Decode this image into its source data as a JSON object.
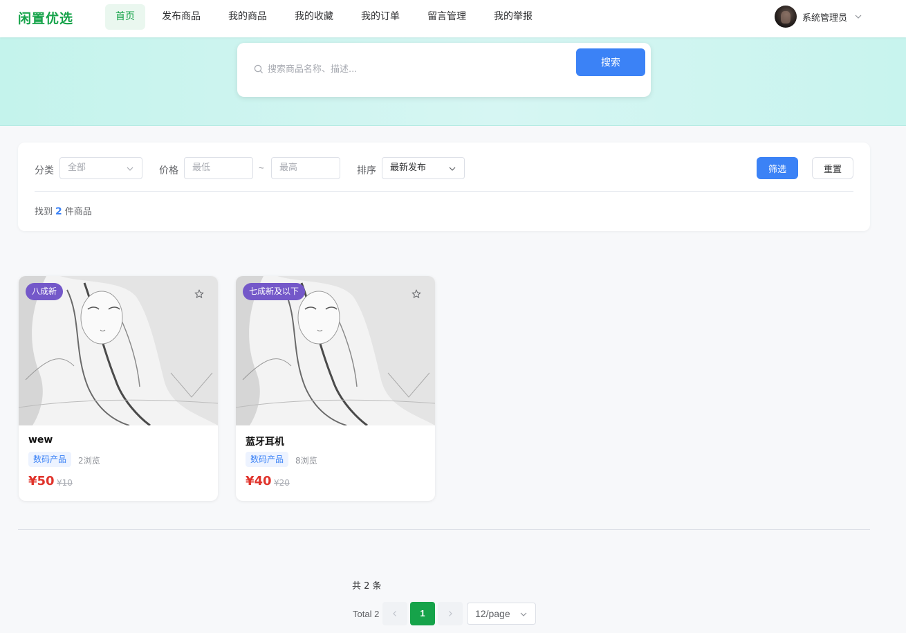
{
  "header": {
    "logo": "闲置优选",
    "nav": [
      {
        "label": "首页",
        "active": true
      },
      {
        "label": "发布商品",
        "active": false
      },
      {
        "label": "我的商品",
        "active": false
      },
      {
        "label": "我的收藏",
        "active": false
      },
      {
        "label": "我的订单",
        "active": false
      },
      {
        "label": "留言管理",
        "active": false
      },
      {
        "label": "我的举报",
        "active": false
      }
    ],
    "user_name": "系统管理员"
  },
  "search": {
    "placeholder": "搜索商品名称、描述...",
    "value": "",
    "button_label": "搜索"
  },
  "filters": {
    "category_label": "分类",
    "category_value": "全部",
    "price_label": "价格",
    "price_min_placeholder": "最低",
    "price_max_placeholder": "最高",
    "price_separator": "~",
    "sort_label": "排序",
    "sort_value": "最新发布",
    "filter_button": "筛选",
    "reset_button": "重置",
    "result_prefix": "找到",
    "result_count": "2",
    "result_suffix": "件商品"
  },
  "products": [
    {
      "condition": "八成新",
      "title": "wew",
      "category": "数码产品",
      "views": "2浏览",
      "price": "¥50",
      "original_price": "¥10"
    },
    {
      "condition": "七成新及以下",
      "title": "蓝牙耳机",
      "category": "数码产品",
      "views": "8浏览",
      "price": "¥40",
      "original_price": "¥20"
    }
  ],
  "pagination": {
    "total_cn": "共 2 条",
    "total_en": "Total 2",
    "current_page": "1",
    "page_size": "12/page"
  },
  "colors": {
    "brand_green": "#16a34a",
    "primary_blue": "#3b82f6",
    "price_red": "#e0342c",
    "badge_purple": "#7458c9"
  },
  "icons": {
    "search": "search-icon",
    "favorite": "star-icon",
    "dropdown": "chevron-down-icon",
    "prev": "chevron-left-icon",
    "next": "chevron-right-icon"
  }
}
